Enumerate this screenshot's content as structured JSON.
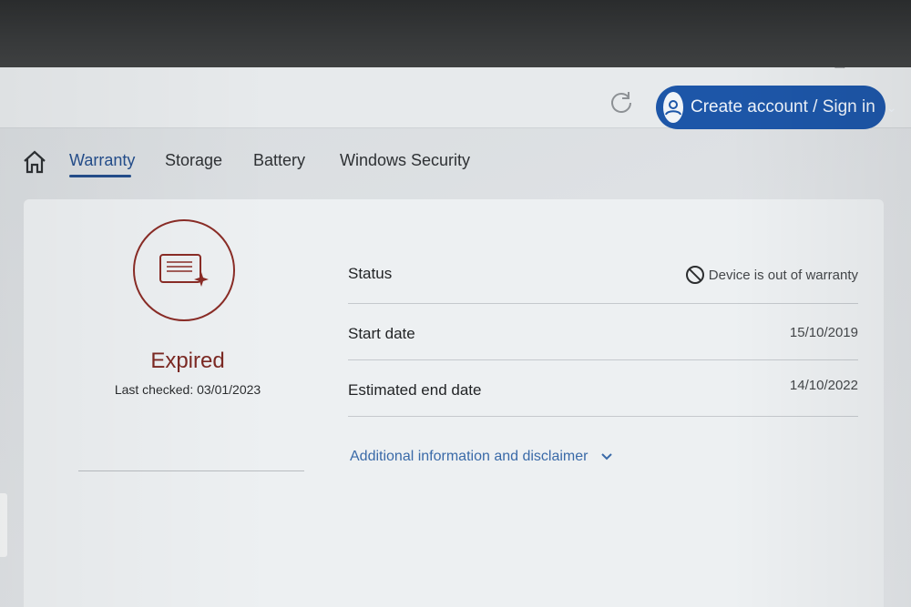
{
  "window": {
    "controls": [
      "minimize",
      "maximize",
      "close"
    ]
  },
  "header": {
    "signin_label": "Create account / Sign in",
    "accent_color": "#1d56a8"
  },
  "tabs": [
    {
      "label": "Warranty",
      "active": true
    },
    {
      "label": "Storage",
      "active": false
    },
    {
      "label": "Battery",
      "active": false
    },
    {
      "label": "Windows Security",
      "active": false
    }
  ],
  "warranty": {
    "state": "Expired",
    "last_checked": "Last checked: 03/01/2023",
    "state_color": "#7c2923",
    "rows": [
      {
        "label": "Status",
        "value": "Device is out of warranty"
      },
      {
        "label": "Start date",
        "value": "15/10/2019"
      },
      {
        "label": "Estimated end date",
        "value": "14/10/2022"
      }
    ],
    "disclaimer": "Additional information and disclaimer"
  },
  "icons": {
    "home": "home-icon",
    "refresh": "refresh-icon",
    "user": "user-icon",
    "certificate": "certificate-icon",
    "blocked": "no-entry-icon",
    "chevron": "chevron-down-icon"
  }
}
